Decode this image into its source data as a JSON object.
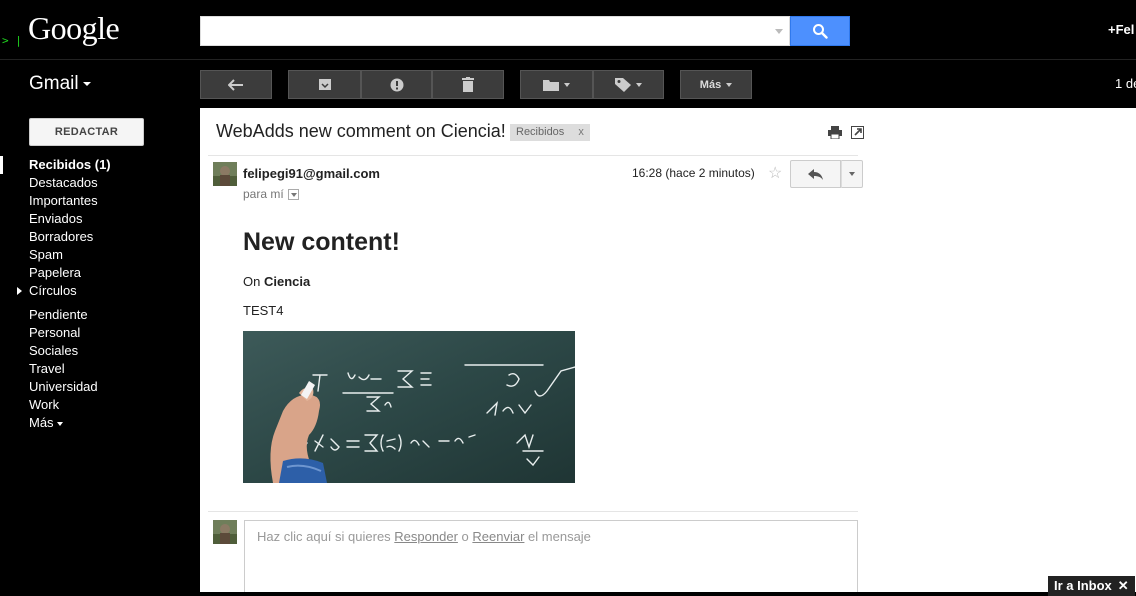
{
  "header": {
    "logo": "Google",
    "logo_deco": "> |",
    "search_value": "",
    "user_link": "+Fel"
  },
  "app": {
    "name": "Gmail"
  },
  "toolbar": {
    "more_label": "Más",
    "page_count": "1 de"
  },
  "sidebar": {
    "compose_label": "REDACTAR",
    "items": [
      {
        "label": "Recibidos (1)"
      },
      {
        "label": "Destacados"
      },
      {
        "label": "Importantes"
      },
      {
        "label": "Enviados"
      },
      {
        "label": "Borradores"
      },
      {
        "label": "Spam"
      },
      {
        "label": "Papelera"
      },
      {
        "label": "Círculos"
      }
    ],
    "labels": [
      {
        "label": "Pendiente"
      },
      {
        "label": "Personal"
      },
      {
        "label": "Sociales"
      },
      {
        "label": "Travel"
      },
      {
        "label": "Universidad"
      },
      {
        "label": "Work"
      },
      {
        "label": "Más"
      }
    ]
  },
  "message": {
    "subject": "WebAdds new comment on Ciencia!",
    "label_chip": "Recibidos",
    "label_chip_close": "x",
    "sender": "felipegi91@gmail.com",
    "to": "para mí",
    "time": "16:28 (hace 2 minutos)",
    "heading": "New content!",
    "on_prefix": "On",
    "on_value": "Ciencia",
    "text": "TEST4"
  },
  "reply": {
    "prefix": "Haz clic aquí si quieres",
    "reply_link": "Responder",
    "or_word": "o",
    "forward_link": "Reenviar",
    "suffix": "el mensaje"
  },
  "footer": {
    "inbox_link": "Ir a Inbox",
    "inbox_close": "✕"
  },
  "colors": {
    "background": "#000000",
    "search_button": "#4d90fe",
    "toolbar_button": "#3c3c3c",
    "content_bg": "#ffffff"
  }
}
